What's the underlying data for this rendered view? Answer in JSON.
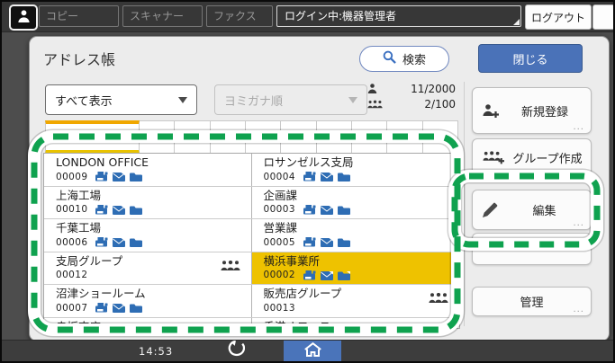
{
  "topbar": {
    "tabs": [
      {
        "label": "コピー"
      },
      {
        "label": "スキャナー"
      },
      {
        "label": "ファクス"
      }
    ],
    "login_status": "ログイン中:機器管理者",
    "logout_label": "ログアウト"
  },
  "panel": {
    "title": "アドレス帳",
    "search_label": "検索",
    "close_label": "閉じる",
    "filter_dropdown_value": "すべて表示",
    "sort_dropdown_value": "ヨミガナ順",
    "counts": {
      "users": "11/2000",
      "groups": "2/100"
    },
    "action_buttons": [
      {
        "label": "新規登録",
        "icon": "user-plus-icon"
      },
      {
        "label": "グループ作成",
        "icon": "group-plus-icon"
      },
      {
        "label": "編集",
        "icon": "pencil-icon"
      },
      {
        "label": "",
        "icon": "minus-glyph"
      },
      {
        "label": "管理",
        "icon": ""
      }
    ],
    "list_rows": [
      [
        {
          "name": "LONDON OFFICE",
          "number": "00009",
          "type": "contact",
          "icons": [
            "fax-icon",
            "mail-icon",
            "folder-icon"
          ],
          "selected": false
        },
        {
          "name": "ロサンゼルス支局",
          "number": "00004",
          "type": "contact",
          "icons": [
            "fax-icon",
            "mail-icon",
            "folder-icon"
          ],
          "selected": false
        }
      ],
      [
        {
          "name": "上海工場",
          "number": "00010",
          "type": "contact",
          "icons": [
            "fax-icon",
            "mail-icon",
            "folder-icon"
          ],
          "selected": false
        },
        {
          "name": "企画課",
          "number": "00003",
          "type": "contact",
          "icons": [
            "fax-icon",
            "mail-icon",
            "folder-icon"
          ],
          "selected": false
        }
      ],
      [
        {
          "name": "千葉工場",
          "number": "00006",
          "type": "contact",
          "icons": [
            "fax-icon",
            "mail-icon",
            "folder-icon"
          ],
          "selected": false
        },
        {
          "name": "営業課",
          "number": "00005",
          "type": "contact",
          "icons": [
            "fax-icon",
            "mail-icon",
            "folder-icon"
          ],
          "selected": false
        }
      ],
      [
        {
          "name": "支局グループ",
          "number": "00012",
          "type": "group",
          "icons": [
            "group-icon"
          ],
          "selected": false
        },
        {
          "name": "横浜事業所",
          "number": "00002",
          "type": "contact",
          "icons": [
            "fax-icon",
            "mail-icon",
            "folder-icon"
          ],
          "selected": true
        }
      ],
      [
        {
          "name": "沼津ショールーム",
          "number": "00007",
          "type": "contact",
          "icons": [
            "fax-icon",
            "mail-icon",
            "folder-icon"
          ],
          "selected": false
        },
        {
          "name": "販売店グループ",
          "number": "00013",
          "type": "group",
          "icons": [
            "group-icon"
          ],
          "selected": false
        }
      ],
      [
        {
          "name": "赤坂支店",
          "number": "",
          "type": "contact",
          "icons": [],
          "selected": false
        },
        {
          "name": "香港オフィス",
          "number": "",
          "type": "contact",
          "icons": [],
          "selected": false
        }
      ]
    ]
  },
  "bottombar": {
    "time": "14:53"
  },
  "colors": {
    "accent_blue": "#4a72b8",
    "selection_yellow": "#eec200",
    "tab_accent_yellow": "#f0a700",
    "annotation_green": "#0fa24f",
    "list_icon_blue": "#2e6db4"
  }
}
